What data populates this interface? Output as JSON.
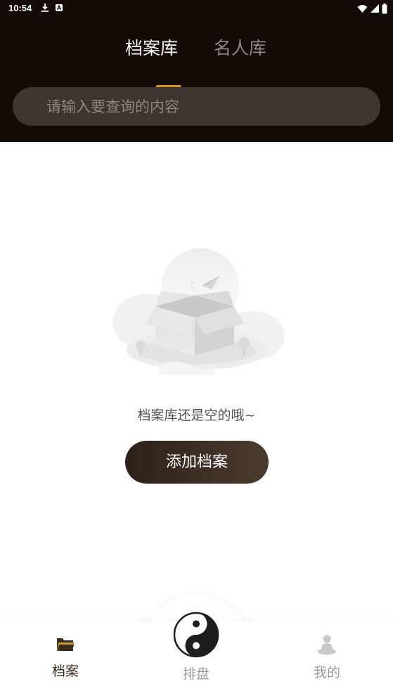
{
  "status_bar": {
    "time": "10:54"
  },
  "tabs": [
    {
      "label": "档案库",
      "active": true
    },
    {
      "label": "名人库",
      "active": false
    }
  ],
  "search": {
    "placeholder": "请输入要查询的内容",
    "value": ""
  },
  "empty_state": {
    "message": "档案库还是空的哦~",
    "button_label": "添加档案"
  },
  "bottom_nav": [
    {
      "label": "档案",
      "icon": "folder-icon",
      "active": true
    },
    {
      "label": "排盘",
      "icon": "yin-yang-icon",
      "active": false
    },
    {
      "label": "我的",
      "icon": "meditating-person-icon",
      "active": false
    }
  ],
  "colors": {
    "header_bg": "#140b06",
    "tab_accent": "#d38f18",
    "button_bg": "#3a2d22",
    "search_bg": "#3c3530"
  }
}
